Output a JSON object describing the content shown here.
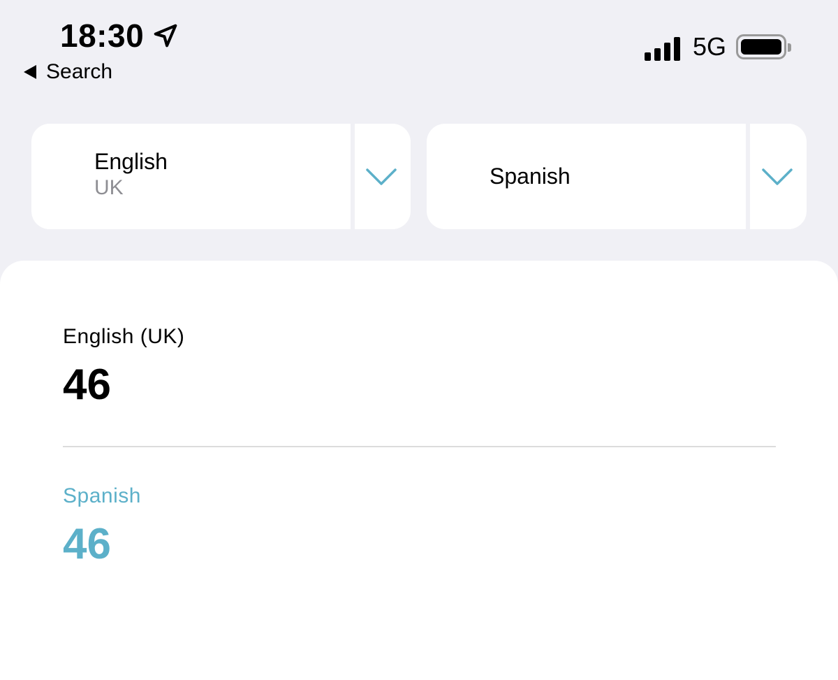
{
  "status_bar": {
    "time": "18:30",
    "back_label": "Search",
    "network": "5G"
  },
  "selectors": {
    "source": {
      "language": "English",
      "variant": "UK"
    },
    "target": {
      "language": "Spanish"
    }
  },
  "results": {
    "source": {
      "label": "English (UK)",
      "count": "46"
    },
    "target": {
      "label": "Spanish",
      "count": "46"
    }
  },
  "colors": {
    "accent": "#5cb0c9",
    "background": "#f0f0f5",
    "secondary_text": "#8e8e93"
  }
}
